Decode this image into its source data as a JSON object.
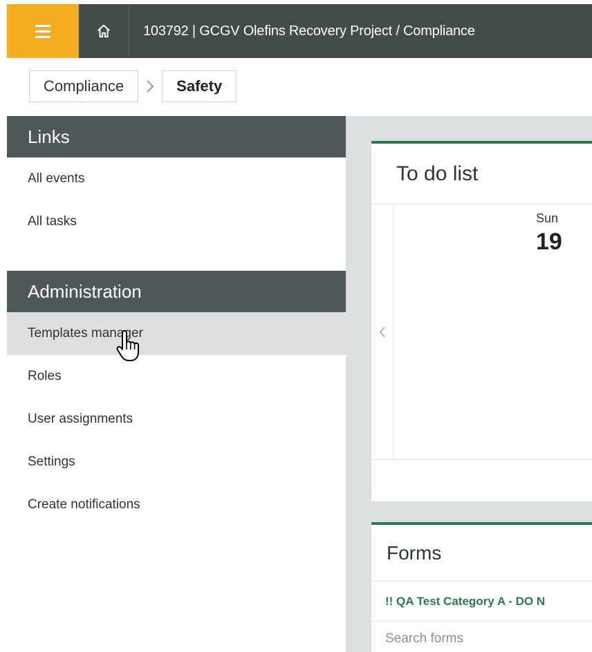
{
  "header": {
    "title": "103792 | GCGV Olefins Recovery Project  /  Compliance",
    "menu_icon": "hamburger-icon",
    "home_icon": "home-icon"
  },
  "breadcrumb": {
    "items": [
      "Compliance",
      "Safety"
    ],
    "separator_icon": "chevron-right-icon"
  },
  "sidebar": {
    "links_header": "Links",
    "links": [
      "All events",
      "All tasks"
    ],
    "admin_header": "Administration",
    "admin_items": [
      "Templates manager",
      "Roles",
      "User assignments",
      "Settings",
      "Create notifications"
    ],
    "hovered_item": "Templates manager"
  },
  "todo": {
    "title": "To do list",
    "day_of_week": "Sun",
    "day_number": "19",
    "prev_icon": "chevron-left-icon"
  },
  "forms": {
    "title": "Forms",
    "category": "!! QA Test Category A - DO N",
    "search_placeholder": "Search forms"
  },
  "colors": {
    "topbar": "#444b4b",
    "menu_accent": "#f3ad1f",
    "section_header": "#4f5858",
    "card_accent": "#2a7a4e"
  }
}
